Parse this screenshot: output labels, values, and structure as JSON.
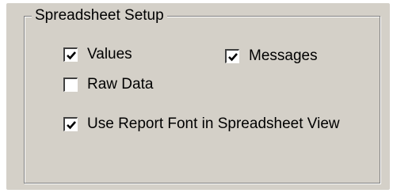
{
  "group": {
    "title": "Spreadsheet Setup"
  },
  "options": {
    "values": {
      "label": "Values",
      "checked": true
    },
    "messages": {
      "label": "Messages",
      "checked": true
    },
    "raw_data": {
      "label": "Raw Data",
      "checked": false
    },
    "use_report_font": {
      "label": "Use Report Font in Spreadsheet View",
      "checked": true
    }
  },
  "icons": {
    "check": "check-mark-icon"
  }
}
